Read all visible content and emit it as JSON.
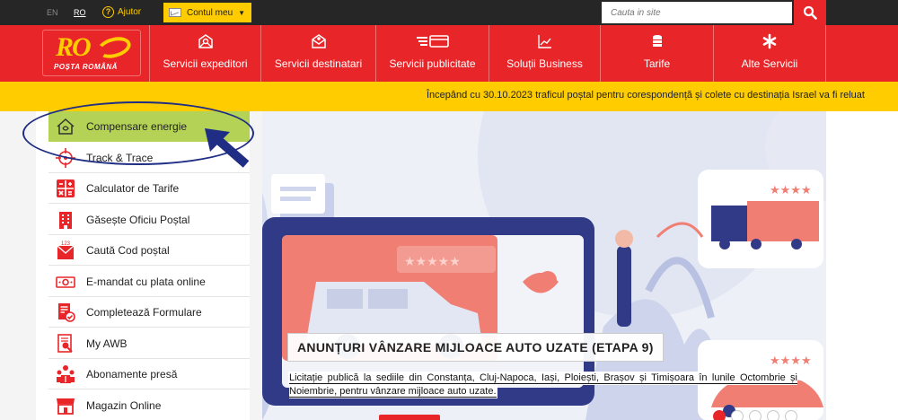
{
  "topbar": {
    "languages": [
      "EN",
      "RO"
    ],
    "help_label": "Ajutor",
    "account_label": "Contul meu",
    "search_placeholder": "Cauta in site"
  },
  "logo": {
    "text": "POȘTA ROMÂNĂ"
  },
  "nav": {
    "items": [
      {
        "label": "Servicii expeditori",
        "icon": "mail-pin-icon"
      },
      {
        "label": "Servicii destinatari",
        "icon": "mail-open-icon"
      },
      {
        "label": "Servicii publicitate",
        "icon": "card-lines-icon"
      },
      {
        "label": "Soluții Business",
        "icon": "chart-line-icon"
      },
      {
        "label": "Tarife",
        "icon": "coins-stack-icon"
      },
      {
        "label": "Alte Servicii",
        "icon": "asterisk-icon"
      }
    ]
  },
  "ticker": {
    "text": "Începând cu 30.10.2023 traficul poștal pentru corespondență și colete cu destinația Israel va fi reluat"
  },
  "sidebar": {
    "items": [
      {
        "label": "Compensare energie",
        "icon": "house-energy-icon",
        "active": true
      },
      {
        "label": "Track & Trace",
        "icon": "crosshair-icon"
      },
      {
        "label": "Calculator de Tarife",
        "icon": "calculator-icon"
      },
      {
        "label": "Găsește Oficiu Poștal",
        "icon": "building-icon"
      },
      {
        "label": "Caută Cod poștal",
        "icon": "postcode-icon"
      },
      {
        "label": "E-mandat cu plata online",
        "icon": "banknote-icon"
      },
      {
        "label": "Completează Formulare",
        "icon": "form-icon"
      },
      {
        "label": "My AWB",
        "icon": "awb-search-icon"
      },
      {
        "label": "Abonamente presă",
        "icon": "press-people-icon"
      },
      {
        "label": "Magazin Online",
        "icon": "shop-icon"
      }
    ]
  },
  "banner": {
    "title": "ANUNȚURI VÂNZARE MIJLOACE AUTO UZATE (ETAPA 9)",
    "text": "Licitație publică la sediile din Constanța, Cluj-Napoca, Iași, Ploiești, Brașov și Timișoara în lunile Octombrie și Noiembrie, pentru vânzare mijloace auto uzate.",
    "slides_total": 5,
    "active_slide": 1
  },
  "colors": {
    "brand_red": "#e8262a",
    "brand_yellow": "#ffcc00",
    "active_green": "#b3d256",
    "annotation_blue": "#1f2d84"
  }
}
